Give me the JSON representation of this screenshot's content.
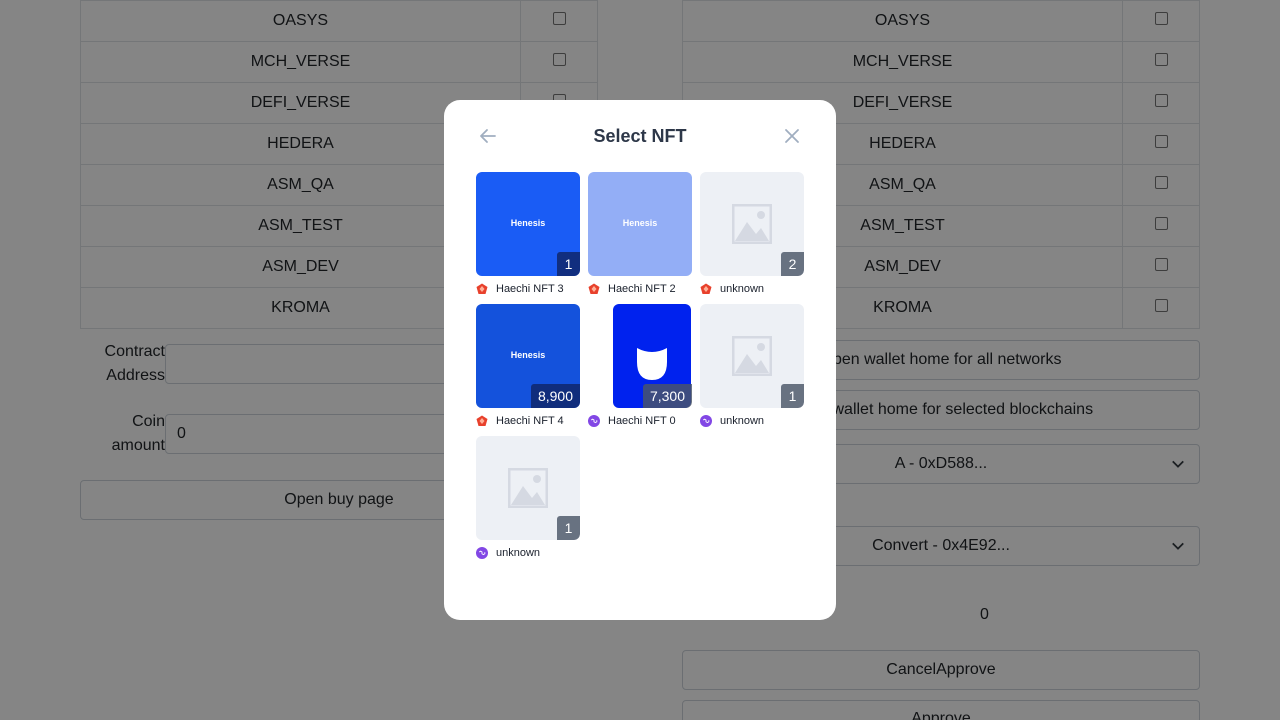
{
  "left_panel": {
    "networks": [
      "OASYS",
      "MCH_VERSE",
      "DEFI_VERSE",
      "HEDERA",
      "ASM_QA",
      "ASM_TEST",
      "ASM_DEV",
      "KROMA"
    ],
    "contract_address_label": "Contract Address",
    "contract_address_value": "",
    "coin_amount_label": "Coin amount",
    "coin_amount_value": "0",
    "open_buy_button": "Open buy page"
  },
  "right_panel": {
    "networks": [
      "OASYS",
      "MCH_VERSE",
      "DEFI_VERSE",
      "HEDERA",
      "ASM_QA",
      "ASM_TEST",
      "ASM_DEV",
      "KROMA"
    ],
    "open_home_all_button": "Open wallet home for all networks",
    "open_home_selected_button": "Open wallet home for selected blockchains",
    "wallet_select_value": "A - 0xD588...",
    "convert_select_value": "Convert - 0x4E92...",
    "allowance_value": "0",
    "cancel_approve_button": "CancelApprove",
    "approve_button": "Approve"
  },
  "modal": {
    "title": "Select NFT",
    "items": [
      {
        "name": "Haechi NFT 3",
        "count": "1",
        "brand": "Henesis",
        "chain": "klaytn"
      },
      {
        "name": "Haechi NFT 2",
        "count": "",
        "brand": "Henesis",
        "chain": "klaytn"
      },
      {
        "name": "unknown",
        "count": "2",
        "brand": "",
        "chain": "klaytn"
      },
      {
        "name": "Haechi NFT 4",
        "count": "8,900",
        "brand": "Henesis",
        "chain": "klaytn"
      },
      {
        "name": "Haechi NFT 0",
        "count": "7,300",
        "brand": "",
        "chain": "polygon"
      },
      {
        "name": "unknown",
        "count": "1",
        "brand": "",
        "chain": "polygon"
      },
      {
        "name": "unknown",
        "count": "1",
        "brand": "",
        "chain": "polygon"
      }
    ]
  },
  "colors": {
    "overlay": "rgba(0,0,0,0.48)",
    "klaytn": "#e8412c",
    "polygon": "#8247e5",
    "henesis_blue": "#1a5cf5"
  }
}
